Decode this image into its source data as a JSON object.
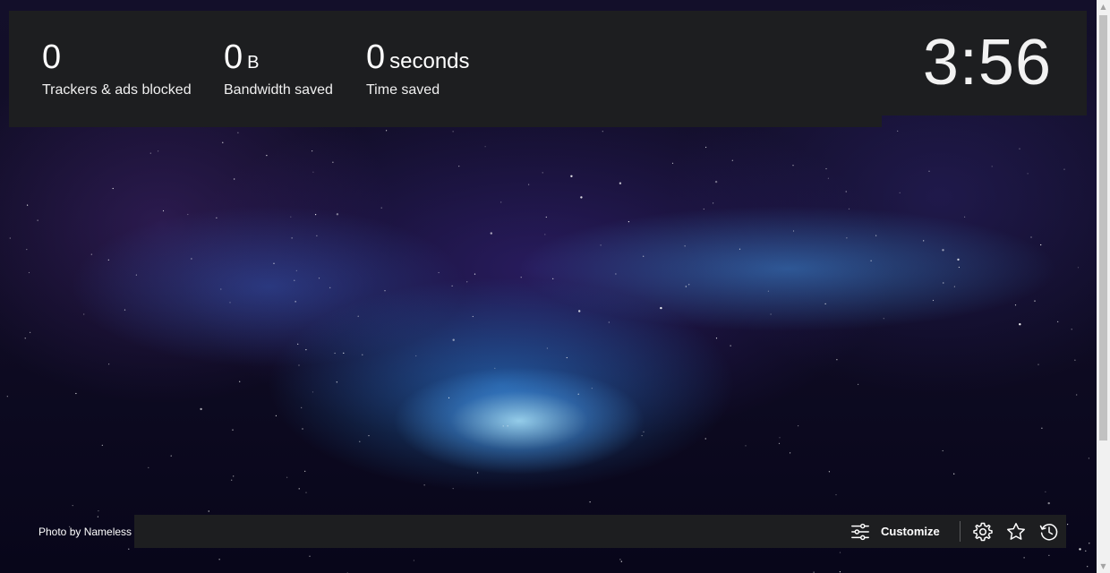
{
  "stats": [
    {
      "value": "0",
      "unit": "",
      "label": "Trackers & ads blocked"
    },
    {
      "value": "0",
      "unit": "B",
      "label": "Bandwidth saved"
    },
    {
      "value": "0",
      "unit": "seconds",
      "label": "Time saved"
    }
  ],
  "clock": {
    "time": "3:56"
  },
  "photo_credit": "Photo by Nameless",
  "toolbar": {
    "customize_label": "Customize",
    "icons": [
      "sliders-icon",
      "gear-icon",
      "star-icon",
      "history-icon"
    ]
  },
  "colors": {
    "panel_bg": "#1d1e20",
    "text": "#ffffff",
    "divider": "#5b5c5f"
  }
}
